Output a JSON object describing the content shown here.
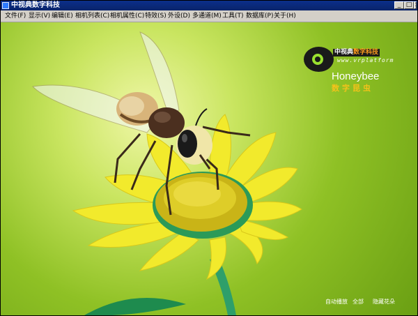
{
  "window": {
    "title": "中视典数字科技",
    "controls": [
      "_",
      "□",
      "×"
    ]
  },
  "menu": [
    {
      "label": "文件(F)"
    },
    {
      "label": "显示(V)"
    },
    {
      "label": "编辑(E)"
    },
    {
      "label": "相机列表(C)"
    },
    {
      "label": "相机属性(C)"
    },
    {
      "label": "特效(S)"
    },
    {
      "label": "外设(D)"
    },
    {
      "label": "多通道(M)"
    },
    {
      "label": "工具(T)"
    },
    {
      "label": "数据库(P)"
    },
    {
      "label": "关于(H)"
    }
  ],
  "logo": {
    "brand_prefix": "中视典",
    "brand_accent": "数字科技",
    "url": "www.vrplatform",
    "icon": "eye-logo-icon"
  },
  "product": {
    "title": "Honeybee",
    "subtitle": "数字昆虫"
  },
  "controls": [
    {
      "label": "自动播放"
    },
    {
      "label": "全部"
    },
    {
      "label": "隐藏花朵"
    }
  ],
  "colors": {
    "titlebar": "#0a246a",
    "menubar": "#d4d0c8",
    "background_green": "#8fc125",
    "logo_accent": "#ff9c1e",
    "subtitle": "#f5c21a"
  }
}
